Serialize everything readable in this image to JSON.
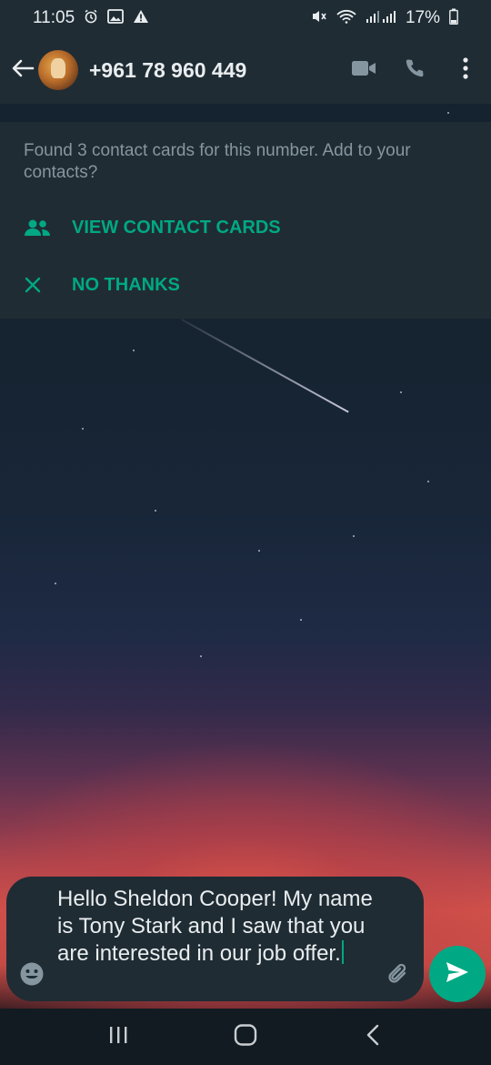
{
  "status_bar": {
    "time": "11:05",
    "battery": "17%"
  },
  "header": {
    "contact_number": "+961 78 960 449"
  },
  "banner": {
    "message": "Found 3 contact cards for this number. Add to your contacts?",
    "view_label": "VIEW CONTACT CARDS",
    "dismiss_label": "NO THANKS"
  },
  "composer": {
    "text": "Hello Sheldon Cooper! My name is Tony Stark and I saw that you are interested in our job offer."
  },
  "icons": {
    "status": [
      "alarm-icon",
      "image-icon",
      "warning-icon",
      "mute-icon",
      "wifi-icon",
      "signal-icon",
      "battery-icon"
    ],
    "header": [
      "back-arrow-icon",
      "video-call-icon",
      "voice-call-icon",
      "more-options-icon"
    ],
    "banner": [
      "contacts-group-icon",
      "close-icon"
    ],
    "composer": [
      "emoji-icon",
      "attach-icon",
      "send-icon"
    ],
    "nav": [
      "recents-icon",
      "home-icon",
      "back-icon"
    ]
  },
  "colors": {
    "accent": "#00a884",
    "bar": "#1f2c34",
    "banner_bg": "#202c33",
    "secondary_text": "#8696a0"
  }
}
